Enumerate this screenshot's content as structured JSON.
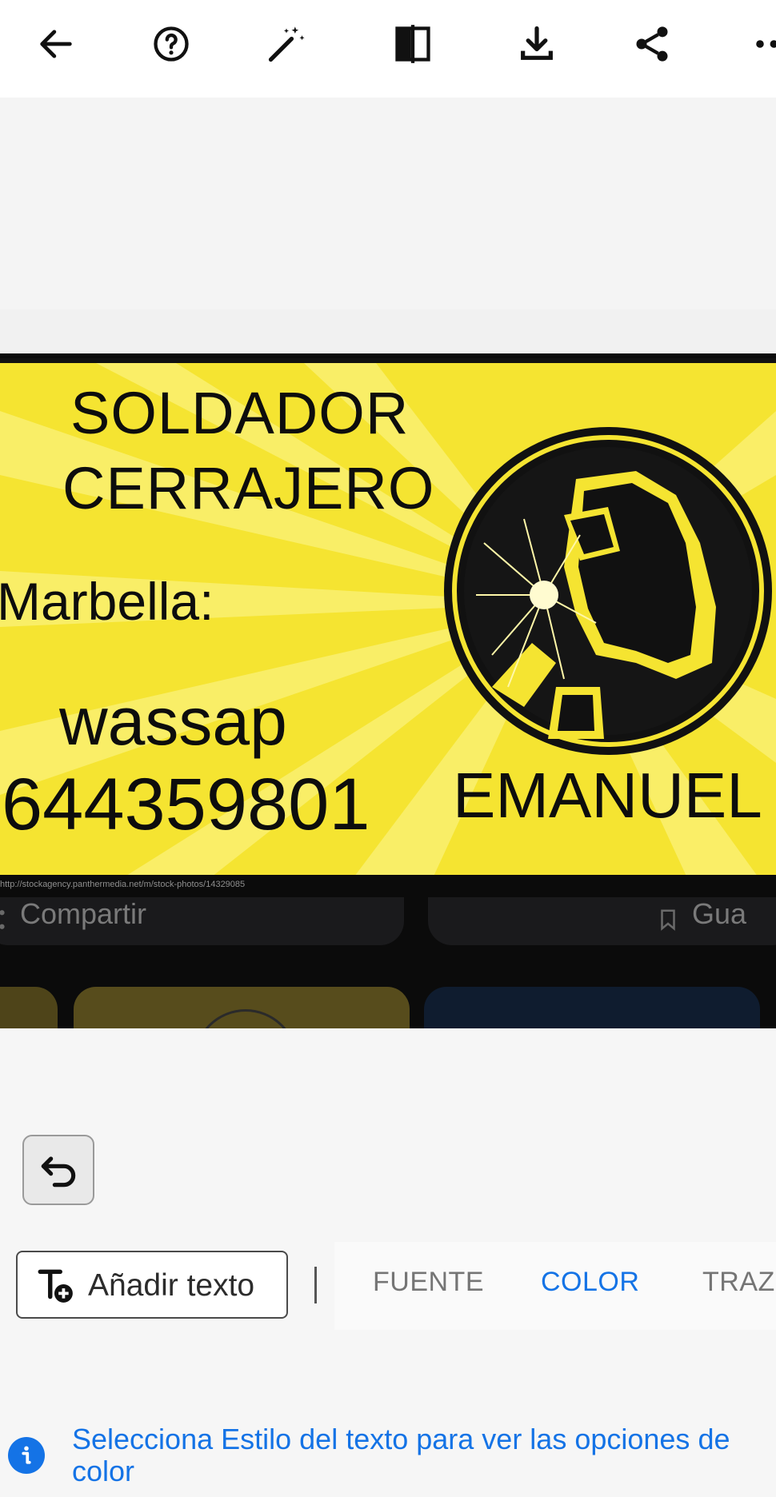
{
  "toolbar": {
    "icons": [
      "back-arrow-icon",
      "help-icon",
      "magic-wand-icon",
      "compare-icon",
      "download-icon",
      "share-icon",
      "more-icon"
    ]
  },
  "image": {
    "card": {
      "line1": "SOLDADOR",
      "line2": "CERRAJERO",
      "city": "Marbella:",
      "wassap": "wassap",
      "phone": "644359801",
      "name": "EMANUEL"
    },
    "watermark_url": "http://stockagency.panthermedia.net/m/stock-photos/14329085",
    "overlay": {
      "share_label": "Compartir",
      "save_label": "Gua"
    }
  },
  "editor": {
    "add_text_label": "Añadir texto",
    "tabs": [
      "FUENTE",
      "COLOR",
      "TRAZO"
    ],
    "active_tab": "COLOR",
    "info_text": "Selecciona Estilo del texto para ver las opciones de\ncolor"
  },
  "colors": {
    "accent": "#1473e6",
    "card_yellow": "#f5e431",
    "toolbar_bg": "#ffffff",
    "workspace_bg": "#f6f6f6"
  }
}
